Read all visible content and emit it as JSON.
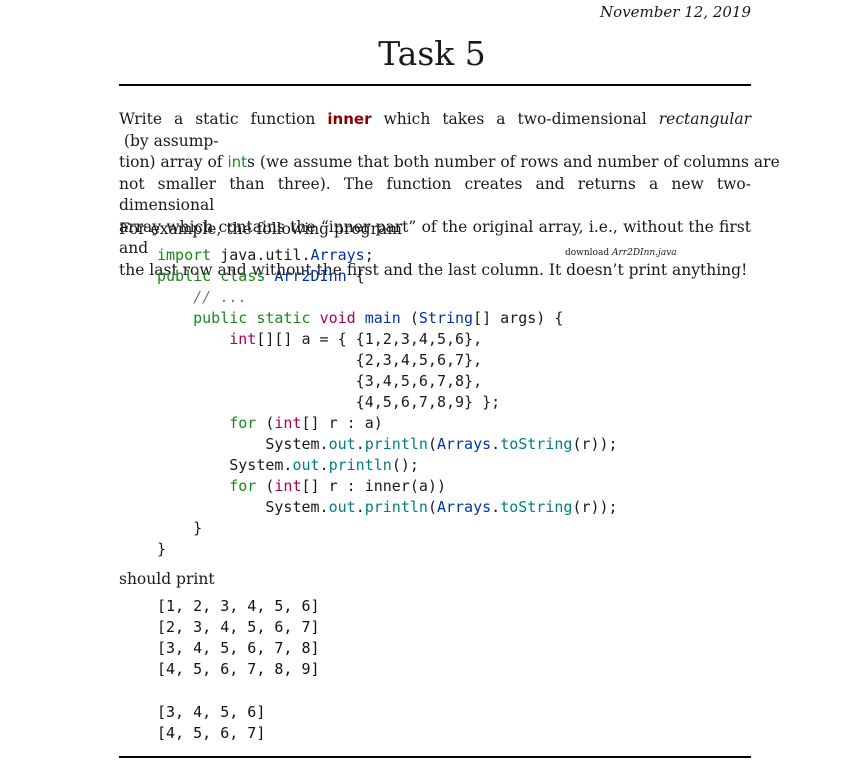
{
  "header": {
    "date": "November 12, 2019"
  },
  "title": "Task 5",
  "description": {
    "lines": [
      "Write a static function inner which takes a two-dimensional rectangular (by assump-",
      "tion) array of ints (we assume that both number of rows and number of columns are",
      "not smaller than three). The function creates and returns a new two-dimensional",
      "array which contains the “inner part” of the original array, i.e., without the first and",
      "the last row and without the first and the last column. It doesn’t print anything!"
    ],
    "keyword_inner": "inner",
    "keyword_ints": "int",
    "word_rectangular": "rectangular"
  },
  "example_intro": "For example, the following program",
  "download": {
    "prefix": "download",
    "filename": "Arr2DInn.java"
  },
  "code": {
    "lines": [
      "import java.util.Arrays;",
      "public class Arr2DInn {",
      "    // ...",
      "    public static void main (String[] args) {",
      "        int[][] a = { {1,2,3,4,5,6},",
      "                      {2,3,4,5,6,7},",
      "                      {3,4,5,6,7,8},",
      "                      {4,5,6,7,8,9} };",
      "        for (int[] r : a)",
      "            System.out.println(Arrays.toString(r));",
      "        System.out.println();",
      "        for (int[] r : inner(a))",
      "            System.out.println(Arrays.toString(r));",
      "    }",
      "}"
    ]
  },
  "should_print": "should print",
  "output": {
    "block1": [
      "[1, 2, 3, 4, 5, 6]",
      "[2, 3, 4, 5, 6, 7]",
      "[3, 4, 5, 6, 7, 8]",
      "[4, 5, 6, 7, 8, 9]"
    ],
    "block2": [
      "[3, 4, 5, 6]",
      "[4, 5, 6, 7]"
    ]
  },
  "colors": {
    "keyword": "#1a8a1a",
    "type": "#b00050",
    "class": "#0033aa",
    "field": "#008080",
    "function_name": "#8b0000"
  }
}
